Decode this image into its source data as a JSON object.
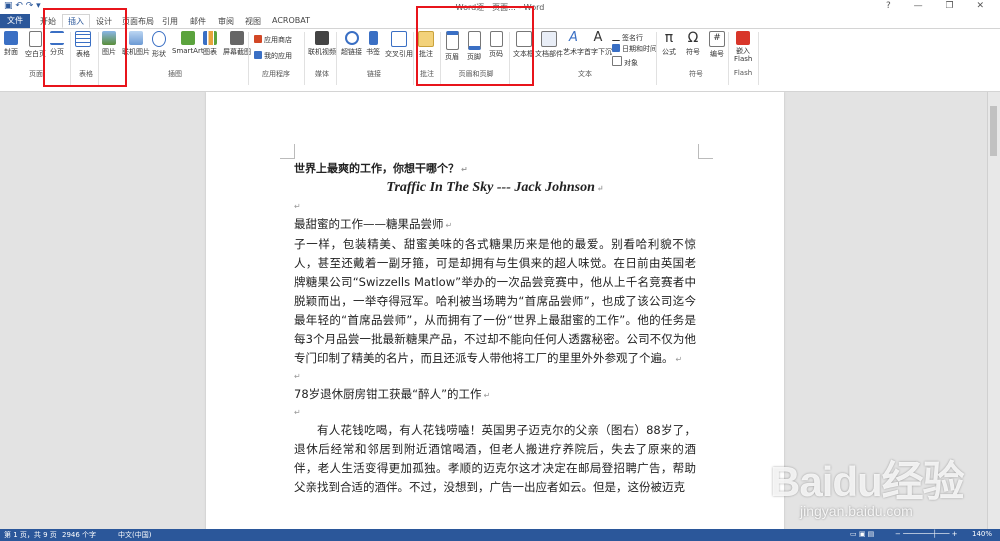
{
  "window": {
    "title": "Word逐一页面... - Word",
    "qat_icons": [
      "save-icon",
      "undo-icon",
      "redo-icon"
    ],
    "controls": [
      "?",
      "—",
      "❐",
      "✕"
    ]
  },
  "tabs": [
    {
      "label": "文件"
    },
    {
      "label": "开始"
    },
    {
      "label": "插入"
    },
    {
      "label": "设计"
    },
    {
      "label": "页面布局"
    },
    {
      "label": "引用"
    },
    {
      "label": "邮件"
    },
    {
      "label": "审阅"
    },
    {
      "label": "视图"
    },
    {
      "label": "ACROBAT"
    }
  ],
  "ribbon": {
    "cover": "封面",
    "blank": "空白页",
    "pagebreak": "分页",
    "group_pages": "页面",
    "table": "表格",
    "group_tables": "表格",
    "picture": "图片",
    "online_pic": "联机图片",
    "shapes": "形状",
    "smartart": "SmartArt",
    "chart": "图表",
    "screenshot": "屏幕截图",
    "group_illus": "插图",
    "store": "应用商店",
    "myapps": "我的应用",
    "group_apps": "应用程序",
    "video": "联机视频",
    "group_media": "媒体",
    "hyperlink": "超链接",
    "bookmark": "书签",
    "crossref": "交叉引用",
    "group_links": "链接",
    "comment": "批注",
    "group_comments": "批注",
    "header": "页眉",
    "footer": "页脚",
    "pagenum": "页码",
    "group_hf": "页眉和页脚",
    "textbox": "文本框",
    "quickparts": "文档部件",
    "wordart": "艺术字",
    "dropcap": "首字下沉",
    "sigline": "签名行",
    "datetime": "日期和时间",
    "object": "对象",
    "group_text": "文本",
    "equation": "公式",
    "symbol": "符号",
    "number": "编号",
    "group_symbols": "符号",
    "flash": "嵌入 Flash",
    "group_flash": "Flash"
  },
  "document": {
    "heading": "世界上最爽的工作，你想干哪个？",
    "song": "Traffic In The Sky --- Jack Johnson",
    "sec1_title": "最甜蜜的工作——糖果品尝师",
    "sec1_body": "子一样，包装精美、甜蜜美味的各式糖果历来是他的最爱。别看哈利貌不惊人，甚至还戴着一副牙箍，可是却拥有与生俱来的超人味觉。在日前由英国老牌糖果公司“Swizzells Matlow”举办的一次品尝竞赛中，他从上千名竞赛者中脱颖而出，一举夺得冠军。哈利被当场聘为“首席品尝师”，也成了该公司迄今最年轻的“首席品尝师”，从而拥有了一份“世界上最甜蜜的工作”。他的任务是每3个月品尝一批最新糖果产品，不过却不能向任何人透露秘密。公司不仅为他专门印制了精美的名片，而且还派专人带他将工厂的里里外外参观了个遍。",
    "sec2_title": "78岁退休厨房钳工获最“醉人”的工作",
    "sec2_body": "有人花钱吃喝，有人花钱唠嗑！英国男子迈克尔的父亲（图右）88岁了，退休后经常和邻居到附近酒馆喝酒，但老人搬进疗养院后，失去了原来的酒伴，老人生活变得更加孤独。孝顺的迈克尔这才决定在邮局登招聘广告，帮助父亲找到合适的酒伴。不过，没想到，广告一出应者如云。但是，这份被迈克"
  },
  "status": {
    "page": "第 1 页，共 9 页",
    "words": "2946 个字",
    "lang": "中文(中国)",
    "zoom": "140%"
  },
  "watermark": {
    "logo": "Baidu经验",
    "url": "jingyan.baidu.com"
  }
}
